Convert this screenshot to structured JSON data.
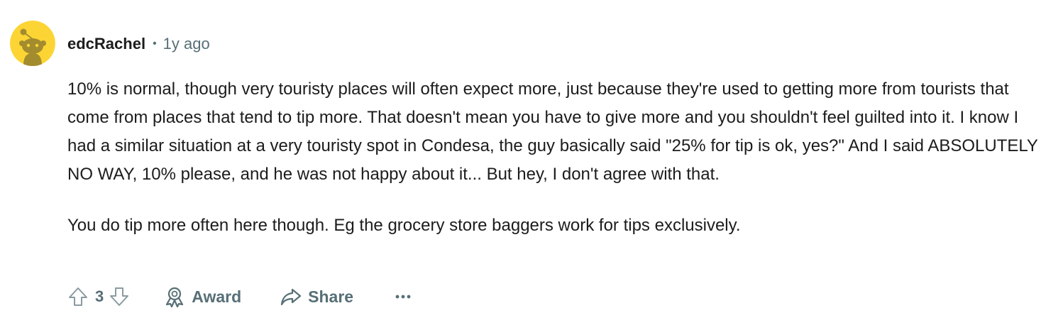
{
  "comment": {
    "author": "edcRachel",
    "separator": "•",
    "timestamp": "1y ago",
    "paragraphs": [
      "10% is normal, though very touristy places will often expect more, just because they're used to getting more from tourists that come from places that tend to tip more. That doesn't mean you have to give more and you shouldn't feel guilted into it. I know I had a similar situation at a very touristy spot in Condesa, the guy basically said \"25% for tip is ok, yes?\" And I said ABSOLUTELY NO WAY, 10% please, and he was not happy about it... But hey, I don't agree with that.",
      "You do tip more often here though. Eg the grocery store baggers work for tips exclusively."
    ],
    "avatar": {
      "icon": "snoo-avatar-icon",
      "background": "#fcd535",
      "figure_color": "#a38c2e"
    }
  },
  "actions": {
    "score": "3",
    "upvote_icon": "upvote-arrow-icon",
    "downvote_icon": "downvote-arrow-icon",
    "award_label": "Award",
    "award_icon": "award-ribbon-icon",
    "share_label": "Share",
    "share_icon": "share-arrow-icon",
    "more_icon": "ellipsis-icon"
  },
  "colors": {
    "text": "#1c1c1c",
    "muted": "#576f76"
  }
}
